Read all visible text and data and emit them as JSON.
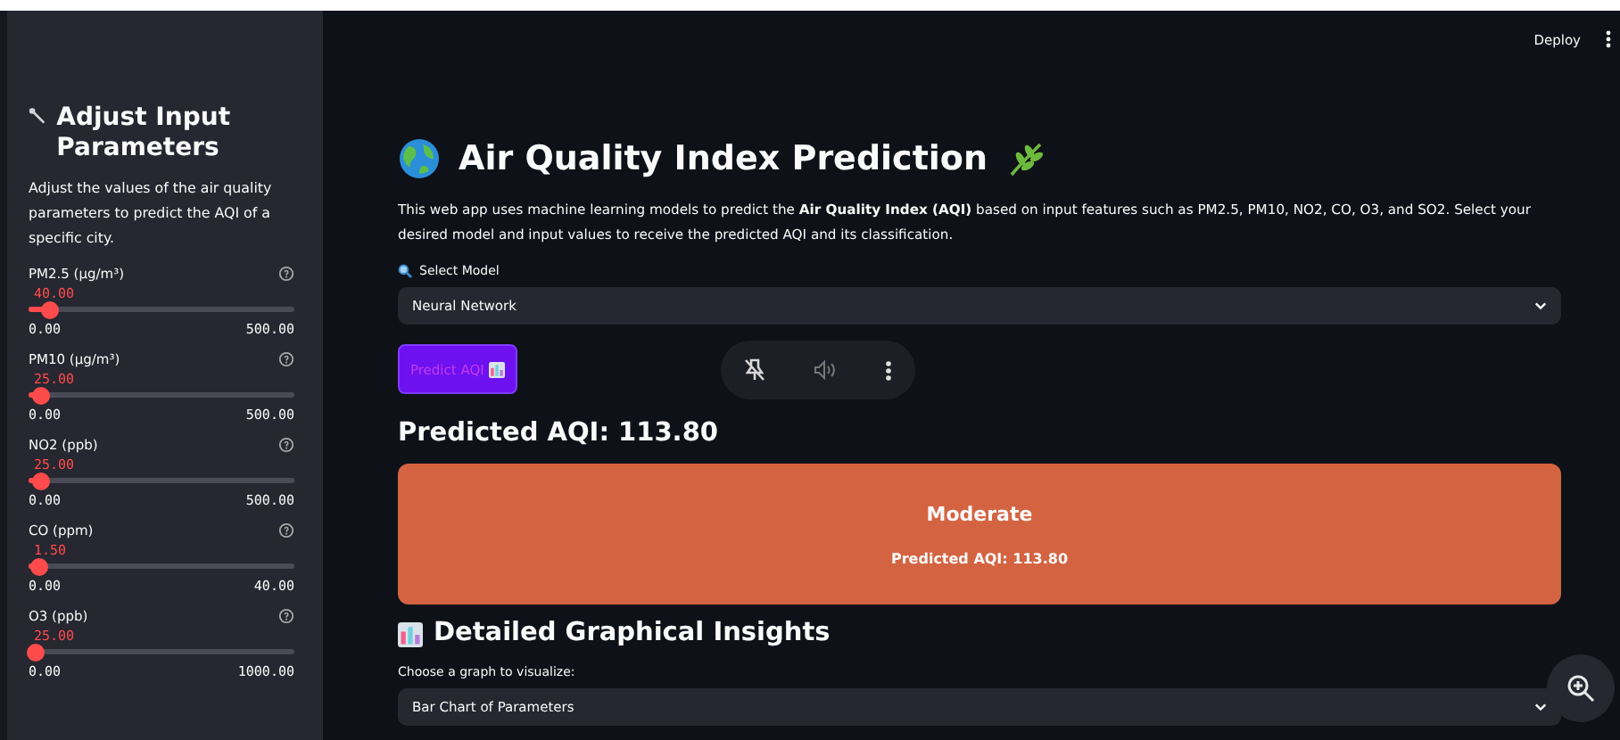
{
  "header": {
    "deploy": "Deploy"
  },
  "sidebar": {
    "title": "Adjust Input Parameters",
    "description": "Adjust the values of the air quality parameters to predict the AQI of a specific city.",
    "sliders": [
      {
        "label": "PM2.5 (µg/m³)",
        "value": "40.00",
        "min": "0.00",
        "max": "500.00",
        "level": 0.08
      },
      {
        "label": "PM10 (µg/m³)",
        "value": "25.00",
        "min": "0.00",
        "max": "500.00",
        "level": 0.05
      },
      {
        "label": "NO2 (ppb)",
        "value": "25.00",
        "min": "0.00",
        "max": "500.00",
        "level": 0.05
      },
      {
        "label": "CO (ppm)",
        "value": "1.50",
        "min": "0.00",
        "max": "40.00",
        "level": 0.0375
      },
      {
        "label": "O3 (ppb)",
        "value": "25.00",
        "min": "0.00",
        "max": "1000.00",
        "level": 0.025
      }
    ]
  },
  "main": {
    "title": "Air Quality Index Prediction",
    "description": "This web app uses machine learning models to predict the **Air Quality Index (AQI)** based on input features such as PM2.5, PM10, NO2, CO, O3, and SO2. Select your desired model and input values to receive the predicted AQI and its classification.",
    "model_label": "Select Model",
    "model_value": "Neural Network",
    "predict_button": "Predict AQI",
    "result_heading": "Predicted AQI: 113.80",
    "result_card": {
      "category": "Moderate",
      "value": "Predicted AQI: 113.80",
      "color": "#d46441"
    },
    "insights_heading": "Detailed Graphical Insights",
    "graph_label": "Choose a graph to visualize:",
    "graph_value": "Bar Chart of Parameters"
  }
}
